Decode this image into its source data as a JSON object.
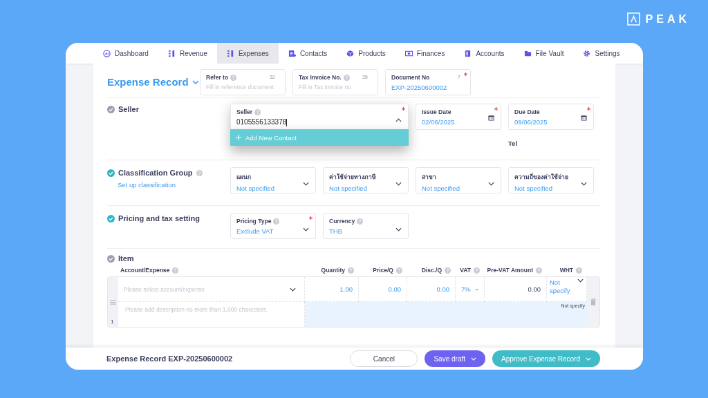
{
  "brand": {
    "name": "PEAK"
  },
  "nav": [
    {
      "label": "Dashboard",
      "selected": false
    },
    {
      "label": "Revenue",
      "selected": false
    },
    {
      "label": "Expenses",
      "selected": true
    },
    {
      "label": "Contacts",
      "selected": false
    },
    {
      "label": "Products",
      "selected": false
    },
    {
      "label": "Finances",
      "selected": false
    },
    {
      "label": "Accounts",
      "selected": false
    },
    {
      "label": "File Vault",
      "selected": false
    },
    {
      "label": "Settings",
      "selected": false
    }
  ],
  "title": "Expense Record",
  "header_fields": [
    {
      "label": "Refer to",
      "help": true,
      "required": false,
      "counter": "32",
      "placeholder": "Fill in reference document"
    },
    {
      "label": "Tax Invoice No.",
      "help": true,
      "required": false,
      "counter": "35",
      "placeholder": "Fill in Tax invoice no."
    },
    {
      "label": "Document No",
      "help": false,
      "required": true,
      "counter": "7",
      "value": "EXP-20250600002"
    }
  ],
  "seller": {
    "label": "Seller",
    "done": false,
    "field": {
      "label": "Seller",
      "help": true,
      "required": true,
      "value": "0105556133378",
      "expanded": true,
      "menu": [
        {
          "label": "Add New Contact",
          "selected": true
        }
      ]
    },
    "dates": [
      {
        "label": "Issue Date",
        "value": "02/06/2025",
        "required": true
      },
      {
        "label": "Due Date",
        "value": "09/06/2025",
        "required": true
      }
    ],
    "tel_label": "Tel"
  },
  "classification": {
    "label": "Classification Group",
    "help": true,
    "done": true,
    "link": "Set up classification",
    "selects": [
      {
        "label": "แผนก",
        "value": "Not specified"
      },
      {
        "label": "ค่าใช้จ่ายทางภาษี",
        "value": "Not specified"
      },
      {
        "label": "สาขา",
        "value": "Not specified"
      },
      {
        "label": "ความถี่ของค่าใช้จ่าย",
        "value": "Not specified"
      }
    ]
  },
  "pricing": {
    "label": "Pricing and tax setting",
    "done": true,
    "selects": [
      {
        "label": "Pricing Type",
        "help": true,
        "required": true,
        "value": "Exclude VAT"
      },
      {
        "label": "Currency",
        "help": true,
        "required": false,
        "value": "THB"
      }
    ]
  },
  "item": {
    "label": "Item",
    "done": false,
    "columns": [
      {
        "label": "Account/Expense"
      },
      {
        "label": "Quantity"
      },
      {
        "label": "Price/Q"
      },
      {
        "label": "Disc./Q"
      },
      {
        "label": "VAT"
      },
      {
        "label": "Pre-VAT Amount"
      },
      {
        "label": "WHT"
      }
    ],
    "rows": [
      {
        "number": "1",
        "account_placeholder": "Please select account/expense",
        "quantity": "1.00",
        "price": "0.00",
        "discount": "0.00",
        "vat": "7%",
        "pre_vat": "0.00",
        "wht": "Not specify",
        "wht_note": "Not specify",
        "description_placeholder": "Please add description no more than 1,000 charecters."
      }
    ]
  },
  "footer": {
    "title": "Expense Record EXP-20250600002",
    "buttons": [
      {
        "label": "Cancel",
        "kind": "secondary",
        "menu": false
      },
      {
        "label": "Save draft",
        "kind": "draft",
        "menu": true
      },
      {
        "label": "Approve Expense Record",
        "kind": "primary",
        "menu": true
      }
    ]
  }
}
